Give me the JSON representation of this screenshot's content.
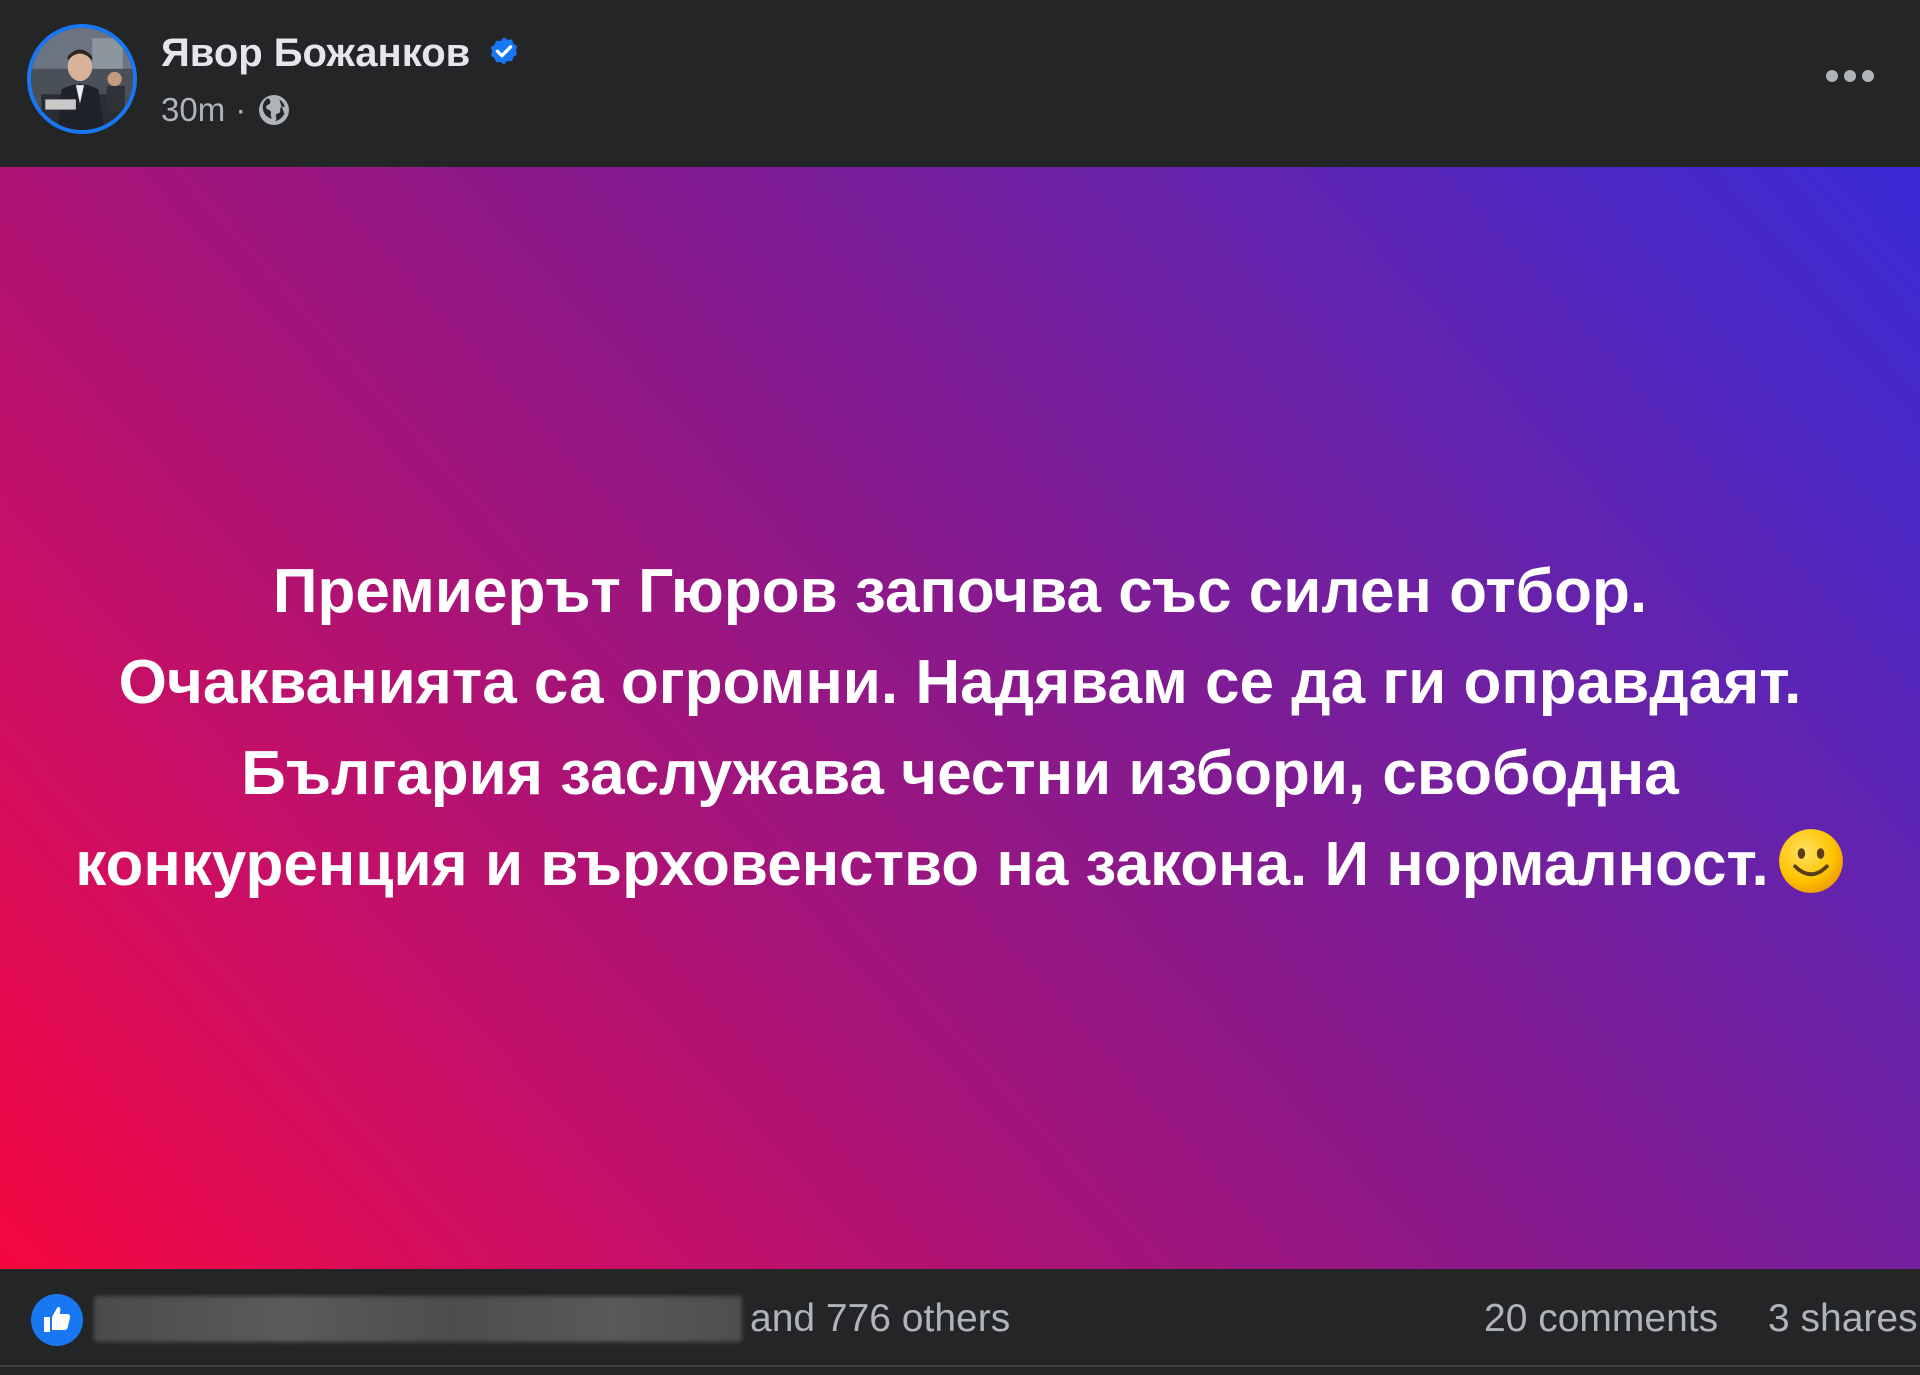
{
  "header": {
    "author_name": "Явор Божанков",
    "timestamp": "30m",
    "separator": "·",
    "icons": {
      "verified": "verified-badge-icon",
      "audience": "globe-icon",
      "menu": "more-horizontal-icon"
    }
  },
  "post": {
    "text": "Премиерът Гюров започва със силен отбор. Очакванията са огромни. Надявам се да ги оправдаят. България заслужава честни избори, свободна конкуренция и върховенство на закона. И нормалност.",
    "emoji": "smiley-face-icon",
    "background_colors": [
      "#f5073f",
      "#a51479",
      "#3a2bd6"
    ]
  },
  "footer": {
    "reaction_icon": "like-icon",
    "reactions_text": "and 776 others",
    "comments": "20 comments",
    "shares": "3 shares"
  },
  "colors": {
    "background": "#242526",
    "accent": "#1877f2",
    "primary_text": "#e4e6eb",
    "secondary_text": "#b0b3b8"
  }
}
